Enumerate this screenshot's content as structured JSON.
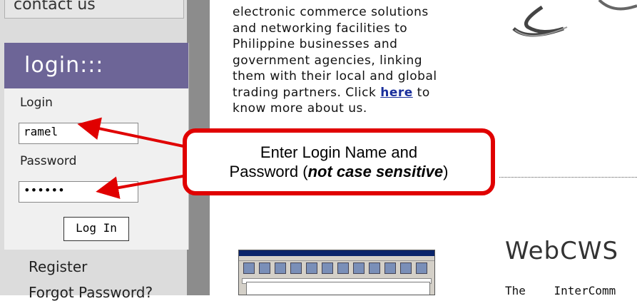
{
  "sidebar": {
    "contact_label": "contact us",
    "login_header": "login:::",
    "login_label": "Login",
    "login_value": "ramel",
    "password_label": "Password",
    "password_value": "••••••",
    "login_button": "Log In",
    "register_label": "Register",
    "forgot_label": "Forgot Password?"
  },
  "intro": {
    "line1": "electronic commerce solutions",
    "line2": "and networking facilities to",
    "line3": "Philippine businesses and",
    "line4": "government agencies, linking",
    "line5": "them with their local and global",
    "line6_pre": "trading partners. Click ",
    "link": "here",
    "line6_post": " to",
    "line7": "know more about us."
  },
  "callout": {
    "line1": "Enter Login Name and",
    "line2_pre": "Password (",
    "line2_em": "not case sensitive",
    "line2_post": ")"
  },
  "webcws": {
    "title": "WebCWS",
    "snippet": "The InterComm"
  },
  "colors": {
    "login_header_bg": "#6d6597",
    "callout_border": "#e00000",
    "link": "#1a2f9c"
  }
}
